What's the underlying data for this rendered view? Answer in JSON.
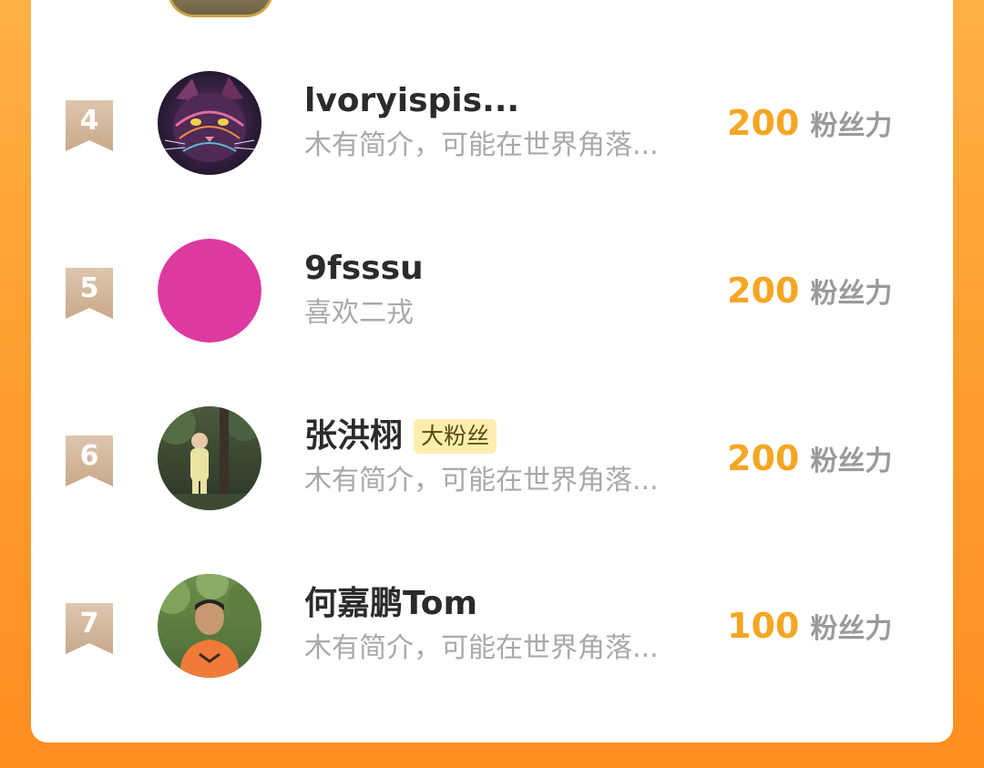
{
  "ranking_list": [
    {
      "rank": "4",
      "name": "lvoryispis...",
      "badge": "",
      "bio": "木有简介，可能在世界角落...",
      "fan_power_value": "200",
      "fan_power_unit": "粉丝力",
      "avatar_icon": "cat-avatar-icon"
    },
    {
      "rank": "5",
      "name": "9fsssu",
      "badge": "",
      "bio": "喜欢二戎",
      "fan_power_value": "200",
      "fan_power_unit": "粉丝力",
      "avatar_icon": "magenta-circle-avatar-icon",
      "avatar_color": "#dd3aa0"
    },
    {
      "rank": "6",
      "name": "张洪栩",
      "badge": "大粉丝",
      "bio": "木有简介，可能在世界角落...",
      "fan_power_value": "200",
      "fan_power_unit": "粉丝力",
      "avatar_icon": "child-photo-avatar-icon"
    },
    {
      "rank": "7",
      "name": "何嘉鹏Tom",
      "badge": "",
      "bio": "木有简介，可能在世界角落...",
      "fan_power_value": "100",
      "fan_power_unit": "粉丝力",
      "avatar_icon": "boy-photo-avatar-icon"
    }
  ],
  "colors": {
    "background_orange": "#ffa033",
    "score_orange": "#f5a623",
    "rank_ribbon": "#d9bea4",
    "badge_bg": "#fdeeb0"
  }
}
